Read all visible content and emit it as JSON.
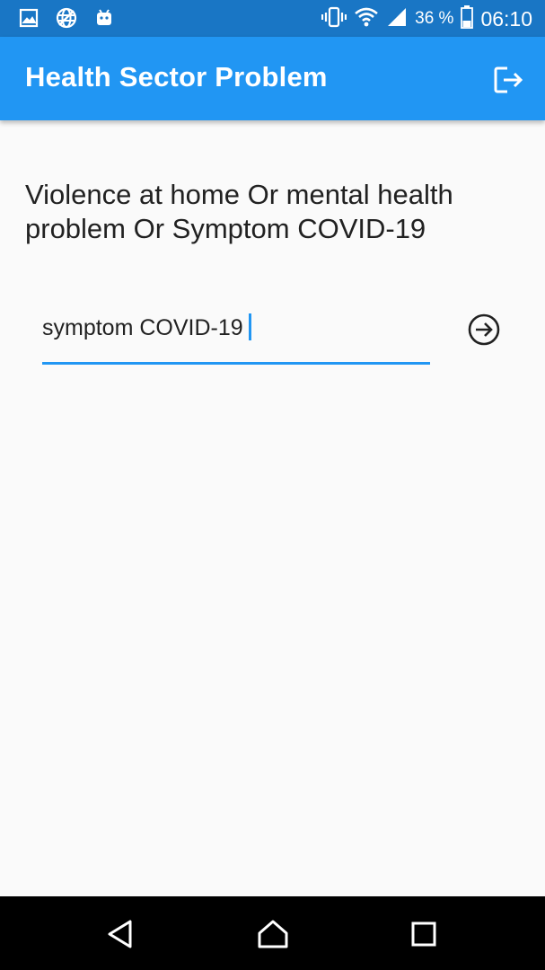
{
  "status_bar": {
    "icons_left": [
      "image-icon",
      "globe-icon",
      "android-icon"
    ],
    "icons_right": [
      "vibrate-icon",
      "wifi-icon",
      "signal-icon",
      "battery-icon"
    ],
    "battery_text": "36 %",
    "time": "06:10"
  },
  "app_bar": {
    "title": "Health Sector Problem",
    "action_icon": "logout-icon"
  },
  "main": {
    "prompt": "Violence at home Or mental health problem Or Symptom COVID-19",
    "input_value": "symptom COVID-19",
    "submit_icon": "arrow-right-circle-icon"
  },
  "nav_bar": {
    "buttons": [
      "back-icon",
      "home-icon",
      "recents-icon"
    ]
  },
  "colors": {
    "status_bar": "#1976c5",
    "app_bar": "#2196f3",
    "accent": "#2196f3",
    "background": "#fafafa",
    "nav_bar": "#000000"
  }
}
